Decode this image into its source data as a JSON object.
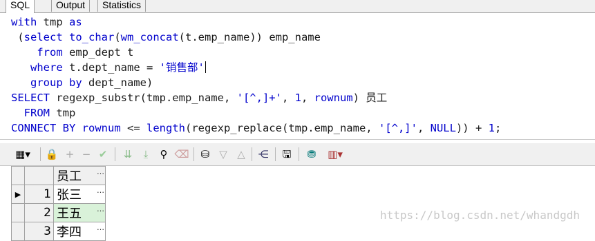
{
  "tabs": [
    {
      "label": "SQL"
    },
    {
      "label": "Output"
    },
    {
      "label": "Statistics"
    }
  ],
  "editor": {
    "lines": [
      [
        {
          "t": "with ",
          "c": "kw"
        },
        {
          "t": "tmp ",
          "c": "id"
        },
        {
          "t": "as",
          "c": "kw"
        }
      ],
      [
        {
          "t": " (",
          "c": "id"
        },
        {
          "t": "select ",
          "c": "kw"
        },
        {
          "t": "to_char",
          "c": "fn"
        },
        {
          "t": "(",
          "c": "id"
        },
        {
          "t": "wm_concat",
          "c": "fn"
        },
        {
          "t": "(t.emp_name)) emp_name",
          "c": "id"
        }
      ],
      [
        {
          "t": "    from ",
          "c": "kw"
        },
        {
          "t": "emp_dept t",
          "c": "id"
        }
      ],
      [
        {
          "t": "   where ",
          "c": "kw"
        },
        {
          "t": "t.dept_name = ",
          "c": "id"
        },
        {
          "t": "'销售部'",
          "c": "str"
        }
      ],
      [
        {
          "t": "   group by ",
          "c": "kw"
        },
        {
          "t": "dept_name)",
          "c": "id"
        }
      ],
      [
        {
          "t": "SELECT ",
          "c": "kw"
        },
        {
          "t": "regexp_substr(tmp.emp_name, ",
          "c": "id"
        },
        {
          "t": "'[^,]+'",
          "c": "str"
        },
        {
          "t": ", ",
          "c": "id"
        },
        {
          "t": "1",
          "c": "str"
        },
        {
          "t": ", ",
          "c": "id"
        },
        {
          "t": "rownum",
          "c": "kw"
        },
        {
          "t": ") 员工",
          "c": "id"
        }
      ],
      [
        {
          "t": "  FROM ",
          "c": "kw"
        },
        {
          "t": "tmp",
          "c": "id"
        }
      ],
      [
        {
          "t": "CONNECT BY ",
          "c": "kw"
        },
        {
          "t": "rownum ",
          "c": "kw"
        },
        {
          "t": "<= ",
          "c": "id"
        },
        {
          "t": "length",
          "c": "fn"
        },
        {
          "t": "(regexp_replace(tmp.emp_name, ",
          "c": "id"
        },
        {
          "t": "'[^,]'",
          "c": "str"
        },
        {
          "t": ", ",
          "c": "id"
        },
        {
          "t": "NULL",
          "c": "kw"
        },
        {
          "t": ")) + ",
          "c": "id"
        },
        {
          "t": "1",
          "c": "str"
        },
        {
          "t": ";",
          "c": "id"
        }
      ]
    ]
  },
  "toolbar": {
    "icons": [
      "grid-menu-icon",
      "lock-icon",
      "add-record-icon",
      "delete-record-icon",
      "post-record-icon",
      "fetch-next-icon",
      "fetch-last-icon",
      "find-icon",
      "clear-icon",
      "query-by-example-icon",
      "filter-down-icon",
      "filter-up-icon",
      "sql-tree-icon",
      "save-icon",
      "export-icon",
      "chart-menu-icon"
    ]
  },
  "grid": {
    "column_header": "员工",
    "rows": [
      {
        "num": "1",
        "value": "张三"
      },
      {
        "num": "2",
        "value": "王五"
      },
      {
        "num": "3",
        "value": "李四"
      }
    ],
    "ellipsis": "…"
  },
  "watermark": "https://blog.csdn.net/whandgdh",
  "colors": {
    "keyword": "#0000cc",
    "selected_row": "#d9f2d9"
  }
}
